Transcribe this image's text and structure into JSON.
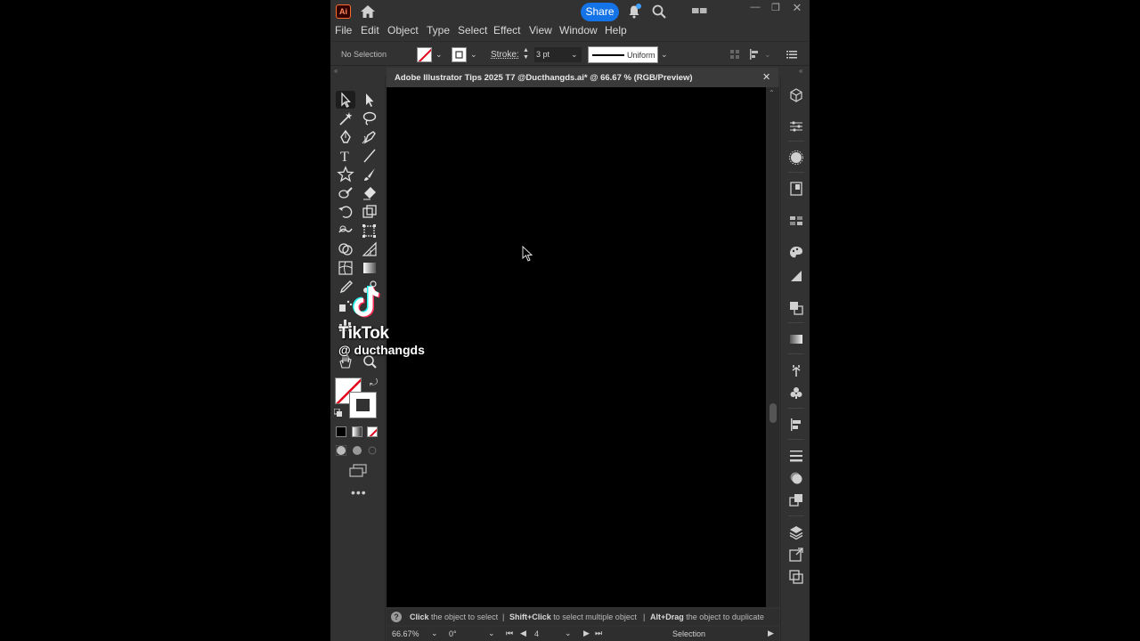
{
  "titlebar": {
    "app_logo": "Ai",
    "share_label": "Share",
    "icons": [
      "home-icon",
      "bell-icon",
      "search-icon",
      "workspace-icon"
    ]
  },
  "menu": [
    "File",
    "Edit",
    "Object",
    "Type",
    "Select",
    "Effect",
    "View",
    "Window",
    "Help"
  ],
  "controlbar": {
    "selection_status": "No Selection",
    "stroke_label": "Stroke:",
    "stroke_value": "3 pt",
    "profile_label": "Uniform"
  },
  "document": {
    "tab_title": "Adobe Illustrator Tips 2025 T7 @Ducthangds.ai* @ 66.67 % (RGB/Preview)",
    "close_glyph": "✕"
  },
  "hint": {
    "part1_bold": "Click",
    "part1": "the object to select",
    "sep": "|",
    "part2_bold": "Shift+Click",
    "part2": "to select multiple object",
    "part3_bold": "Alt+Drag",
    "part3": "the object to duplicate"
  },
  "statusbar": {
    "zoom": "66.67%",
    "rotation": "0°",
    "artboard": "4",
    "mode": "Selection"
  },
  "overlay": {
    "brand": "TikTok",
    "handle": "@ ducthangds"
  },
  "colors": {
    "accent": "#1473e6",
    "panel": "#323232",
    "canvas": "#000000"
  }
}
